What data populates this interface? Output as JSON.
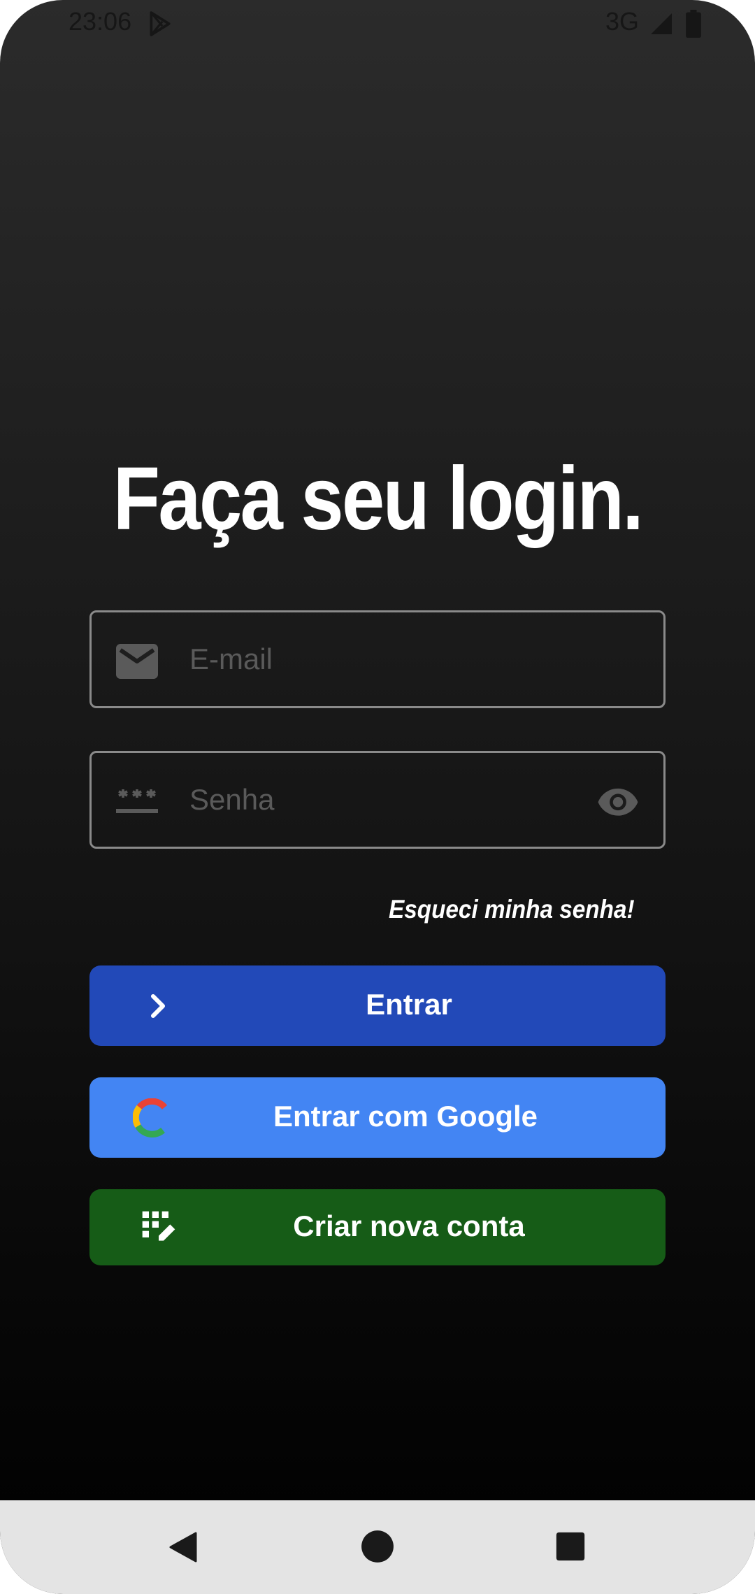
{
  "status_bar": {
    "time": "23:06",
    "network": "3G",
    "icons": [
      "play-store-icon",
      "signal-icon",
      "battery-icon"
    ]
  },
  "login": {
    "title": "Faça seu login.",
    "email": {
      "placeholder": "E-mail",
      "value": "",
      "icon": "email-icon"
    },
    "password": {
      "placeholder": "Senha",
      "value": "",
      "icon": "password-icon",
      "toggle_icon": "eye-icon"
    },
    "forgot_password": "Esqueci minha senha!",
    "buttons": {
      "enter": {
        "label": "Entrar",
        "icon": "chevron-right-icon",
        "color": "#2249b8"
      },
      "google": {
        "label": "Entrar com Google",
        "icon": "google-icon",
        "color": "#4385f3"
      },
      "create": {
        "label": "Criar nova conta",
        "icon": "keypad-edit-icon",
        "color": "#165c17"
      }
    }
  },
  "colors": {
    "background_top": "#2b2b2b",
    "background_bottom": "#000000",
    "field_border": "#8a8a8a",
    "placeholder": "#5a5a5a",
    "nav_bar": "#e4e4e4"
  },
  "nav_bar": {
    "icons": [
      "back-icon",
      "home-icon",
      "recent-apps-icon"
    ]
  }
}
